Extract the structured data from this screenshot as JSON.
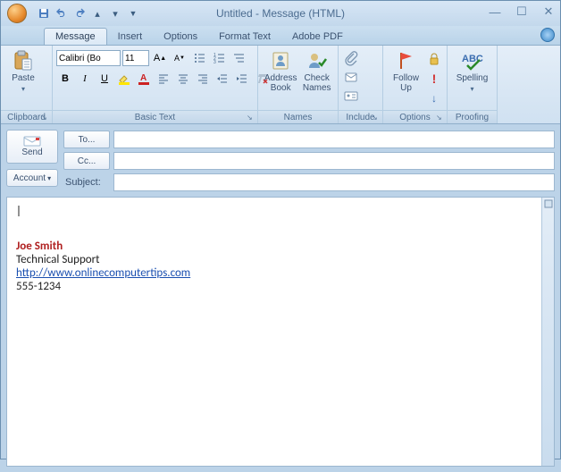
{
  "title": "Untitled - Message (HTML)",
  "tabs": [
    "Message",
    "Insert",
    "Options",
    "Format Text",
    "Adobe PDF"
  ],
  "activeTab": 0,
  "ribbon": {
    "clipboard": {
      "paste": "Paste",
      "label": "Clipboard"
    },
    "basicText": {
      "font": "Calibri (Bo",
      "size": "11",
      "label": "Basic Text"
    },
    "names": {
      "address": "Address\nBook",
      "check": "Check\nNames",
      "label": "Names"
    },
    "include": {
      "label": "Include"
    },
    "options": {
      "follow": "Follow\nUp",
      "label": "Options"
    },
    "proofing": {
      "spelling": "Spelling",
      "label": "Proofing"
    }
  },
  "compose": {
    "send": "Send",
    "account": "Account",
    "to": "To...",
    "cc": "Cc...",
    "subjectLabel": "Subject:",
    "toVal": "",
    "ccVal": "",
    "subjectVal": ""
  },
  "signature": {
    "name": "Joe Smith",
    "role": "Technical Support",
    "url": "http://www.onlinecomputertips.com",
    "phone": "555-1234"
  }
}
